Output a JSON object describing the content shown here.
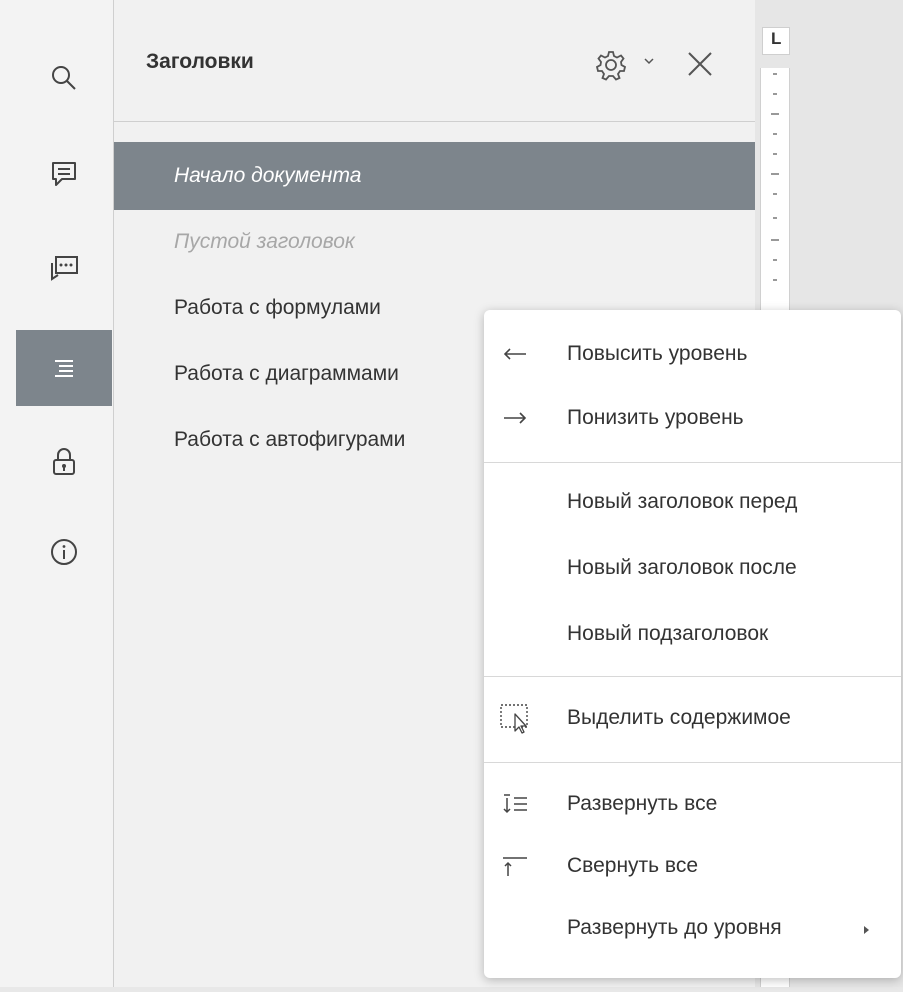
{
  "panel": {
    "title": "Заголовки",
    "items": [
      {
        "label": "Начало документа"
      },
      {
        "label": "Пустой заголовок"
      },
      {
        "label": "Работа с формулами"
      },
      {
        "label": "Работа с диаграммами"
      },
      {
        "label": "Работа с автофигурами"
      }
    ]
  },
  "ruler": {
    "corner_label": "L"
  },
  "context_menu": {
    "items": [
      {
        "label": "Повысить уровень",
        "icon": "arrow-left-icon"
      },
      {
        "label": "Понизить уровень",
        "icon": "arrow-right-icon"
      },
      {
        "label": "Новый заголовок перед"
      },
      {
        "label": "Новый заголовок после"
      },
      {
        "label": "Новый подзаголовок"
      },
      {
        "label": "Выделить содержимое",
        "icon": "select-content-icon"
      },
      {
        "label": "Развернуть все",
        "icon": "expand-all-icon"
      },
      {
        "label": "Свернуть все",
        "icon": "collapse-all-icon"
      },
      {
        "label": "Развернуть до уровня",
        "icon": "submenu-arrow-icon"
      }
    ]
  },
  "colors": {
    "selected": "#7d858c",
    "panel_bg": "#f1f1f1",
    "menu_bg": "#ffffff"
  }
}
